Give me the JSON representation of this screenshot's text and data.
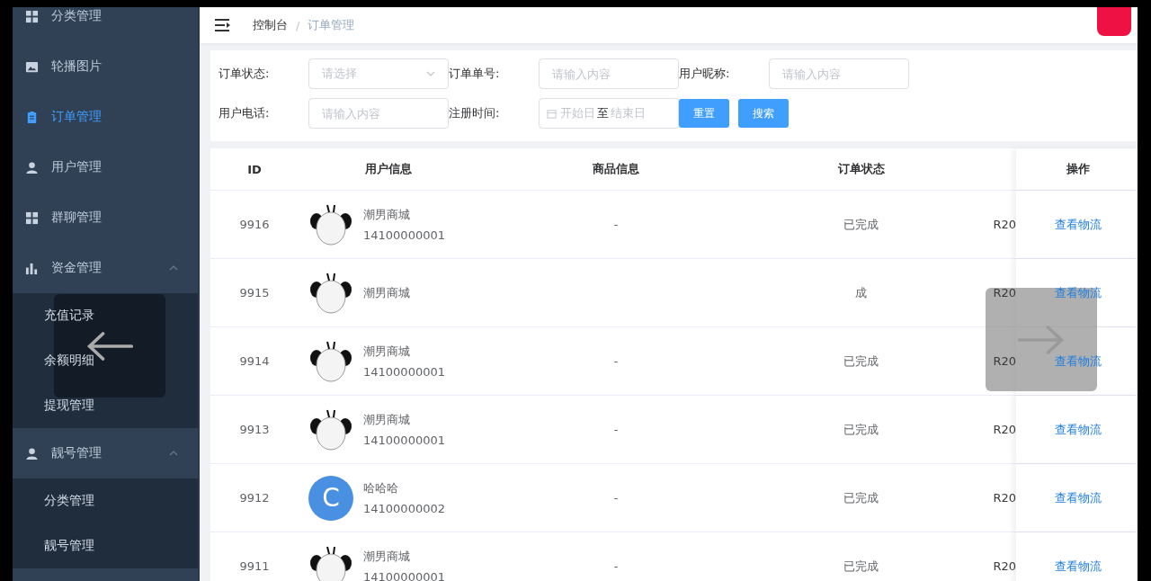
{
  "sidebar": {
    "items": [
      {
        "label": "分类管理",
        "selected": false
      },
      {
        "label": "轮播图片",
        "selected": false
      },
      {
        "label": "订单管理",
        "selected": true
      },
      {
        "label": "用户管理",
        "selected": false
      },
      {
        "label": "群聊管理",
        "selected": false
      },
      {
        "label": "资金管理",
        "selected": false,
        "expanded": true,
        "children": [
          {
            "label": "充值记录",
            "selected": false
          },
          {
            "label": "余额明细",
            "selected": false
          },
          {
            "label": "提现管理",
            "selected": false
          }
        ]
      },
      {
        "label": "靓号管理",
        "selected": false,
        "expanded": true,
        "children": [
          {
            "label": "分类管理",
            "selected": false
          },
          {
            "label": "靓号管理",
            "selected": false
          }
        ]
      }
    ]
  },
  "breadcrumb": {
    "items": [
      "控制台",
      "订单管理"
    ],
    "separator": "/"
  },
  "filters": [
    {
      "label": "订单状态:",
      "kind": "select",
      "placeholder": "请选择"
    },
    {
      "label": "订单单号:",
      "kind": "input",
      "placeholder": "请输入内容"
    },
    {
      "label": "用户昵称:",
      "kind": "input",
      "placeholder": "请输入内容"
    },
    {
      "label": "用户电话:",
      "kind": "input",
      "placeholder": "请输入内容"
    },
    {
      "label": "注册时间:",
      "kind": "daterange",
      "start": "开始日",
      "separator": "至",
      "end": "结束日"
    }
  ],
  "buttons": [
    "重置",
    "搜索"
  ],
  "table": {
    "columns": [
      "ID",
      "用户信息",
      "商品信息",
      "订单状态",
      "",
      "操作"
    ],
    "rows": [
      {
        "id": "9916",
        "name": "潮男商城",
        "phone": "14100000001",
        "goods": "-",
        "status": "已完成",
        "column_5": "R20",
        "action": "查看物流"
      },
      {
        "id": "9915",
        "name": "潮男商城",
        "status": "成",
        "column_5": "R20",
        "action": "查看物流"
      },
      {
        "id": "9914",
        "name": "潮男商城",
        "phone": "14100000001",
        "goods": "-",
        "status": "已完成",
        "column_5": "R20",
        "action": "查看物流"
      },
      {
        "id": "9913",
        "name": "潮男商城",
        "phone": "14100000001",
        "goods": "-",
        "status": "已完成",
        "column_5": "R20",
        "action": "查看物流"
      },
      {
        "id": "9912",
        "avatar_letter": "C",
        "name": "哈哈哈",
        "phone": "14100000002",
        "goods": "-",
        "status": "已完成",
        "column_5": "R20",
        "action": "查看物流"
      },
      {
        "id": "9911",
        "name": "潮男商城",
        "phone": "14100000001",
        "goods": "-",
        "status": "已完成",
        "column_5": "R20",
        "action": "查看物流"
      }
    ]
  }
}
